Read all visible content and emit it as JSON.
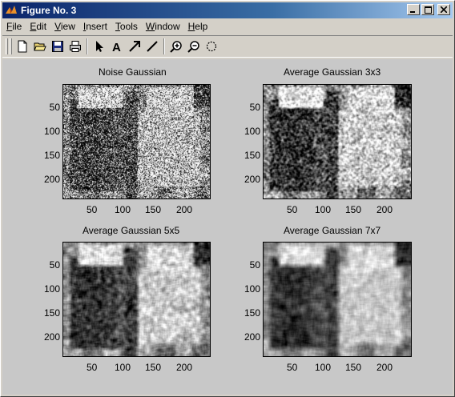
{
  "window": {
    "title": "Figure No. 3"
  },
  "menu": [
    {
      "label": "File",
      "u": "F",
      "rest": "ile"
    },
    {
      "label": "Edit",
      "u": "E",
      "rest": "dit"
    },
    {
      "label": "View",
      "u": "V",
      "rest": "iew"
    },
    {
      "label": "Insert",
      "u": "I",
      "rest": "nsert"
    },
    {
      "label": "Tools",
      "u": "T",
      "rest": "ools"
    },
    {
      "label": "Window",
      "u": "W",
      "rest": "indow"
    },
    {
      "label": "Help",
      "u": "H",
      "rest": "elp"
    }
  ],
  "toolbar": {
    "icons": [
      "new-file-icon",
      "open-folder-icon",
      "save-icon",
      "print-icon",
      "pointer-icon",
      "text-insert-icon",
      "arrow-insert-icon",
      "line-insert-icon",
      "zoom-in-icon",
      "zoom-out-icon",
      "rotate-icon"
    ]
  },
  "subplots": [
    {
      "title": "Noise Gaussian",
      "blur": 0,
      "noise": 0.9
    },
    {
      "title": "Average Gaussian 3x3",
      "blur": 1,
      "noise": 0.35
    },
    {
      "title": "Average Gaussian 5x5",
      "blur": 2,
      "noise": 0.18
    },
    {
      "title": "Average Gaussian 7x7",
      "blur": 3,
      "noise": 0.1
    }
  ],
  "axes": {
    "xticks": [
      "50",
      "100",
      "150",
      "200"
    ],
    "yticks": [
      "50",
      "100",
      "150",
      "200"
    ]
  }
}
